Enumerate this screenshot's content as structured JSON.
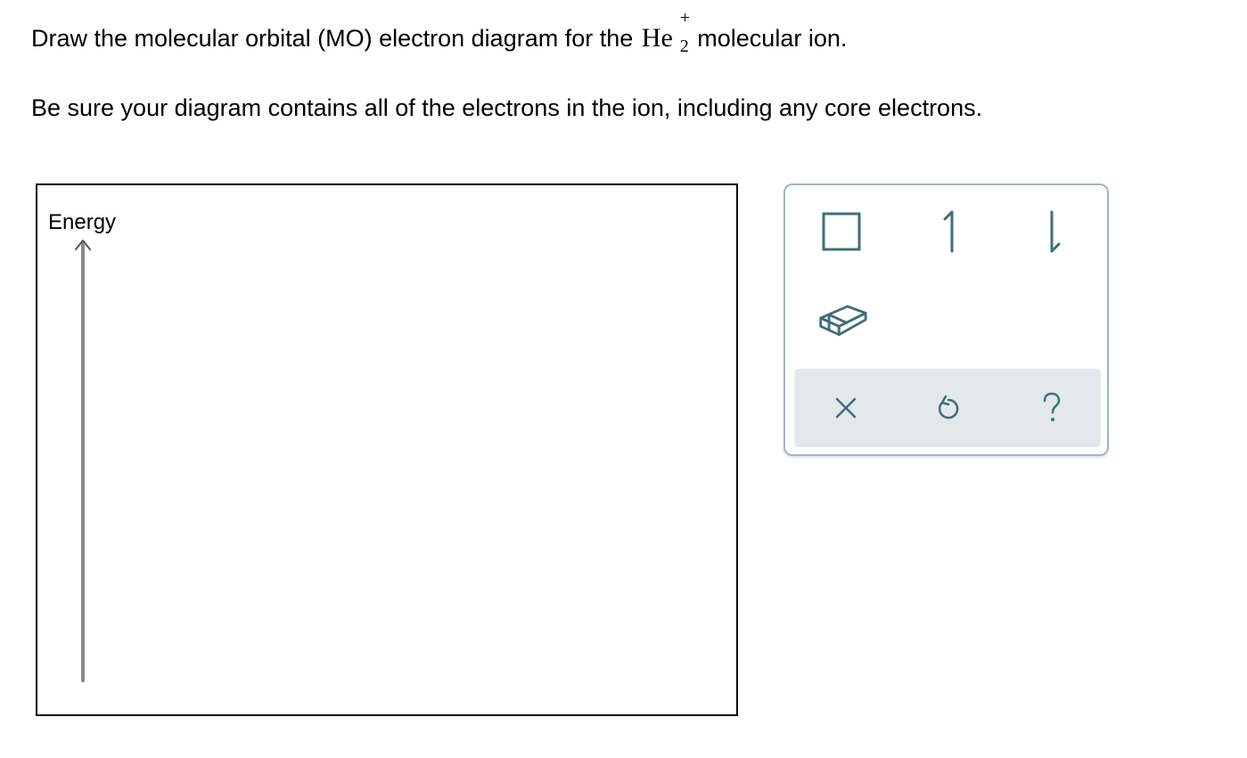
{
  "prompt": {
    "line1_before": "Draw the molecular orbital (MO) electron diagram for the",
    "formula_base": "He",
    "formula_subscript": "2",
    "formula_superscript": "+",
    "line1_after": "molecular ion.",
    "line2": "Be sure your diagram contains all of the electrons in the ion, including any core electrons."
  },
  "canvas": {
    "axis_label": "Energy"
  },
  "toolbox": {
    "tools": [
      {
        "name": "orbital-box-tool",
        "icon": "square-box-icon"
      },
      {
        "name": "spin-up-electron-tool",
        "icon": "half-arrow-up-icon"
      },
      {
        "name": "spin-down-electron-tool",
        "icon": "half-arrow-down-icon"
      },
      {
        "name": "eraser-tool",
        "icon": "eraser-icon"
      }
    ],
    "actions": [
      {
        "name": "clear-button",
        "icon": "x-icon"
      },
      {
        "name": "undo-button",
        "icon": "undo-icon"
      },
      {
        "name": "help-button",
        "icon": "question-mark-icon"
      }
    ],
    "icon_color": "#3f6f78",
    "action_bar_color": "#e2e8eb",
    "border_color": "#9fb7c2"
  }
}
